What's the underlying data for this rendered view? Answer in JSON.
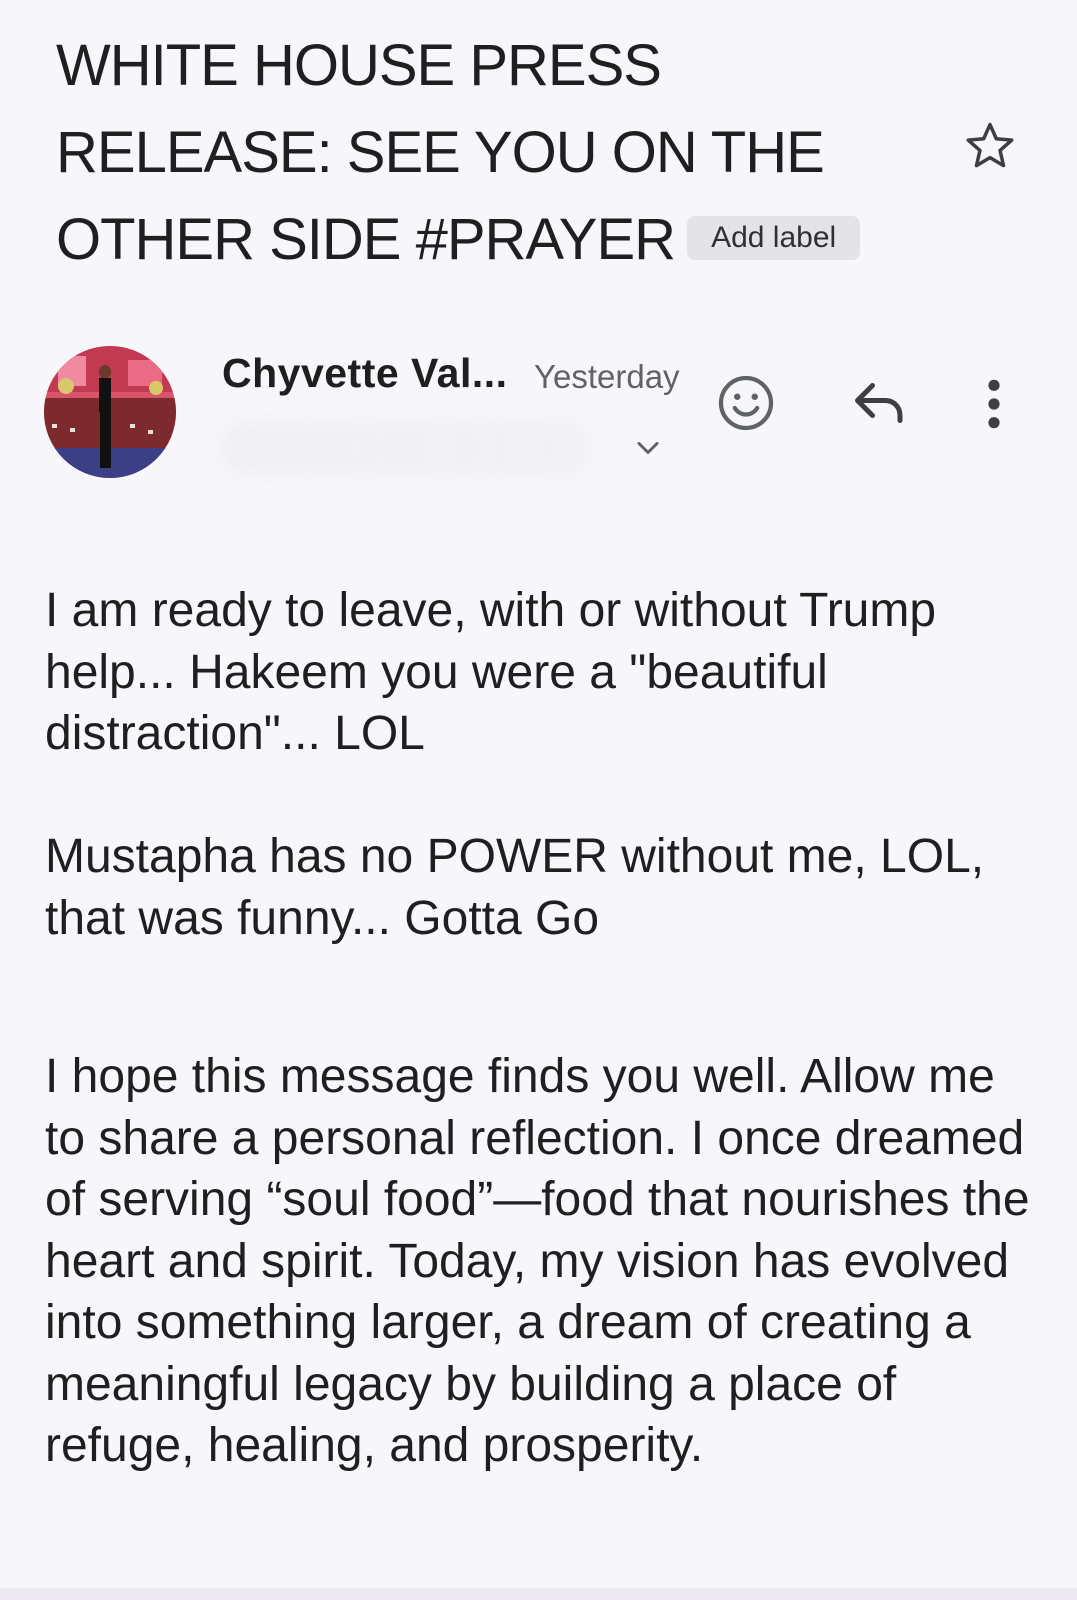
{
  "email": {
    "subject": "WHITE HOUSE PRESS RELEASE: SEE YOU ON THE OTHER SIDE #PRAYER",
    "add_label": "Add label",
    "sender_name": "Chyvette Val...",
    "time": "Yesterday",
    "paragraphs": [
      "I am ready to leave, with or without Trump help... Hakeem you were a \"beautiful distraction\"... LOL",
      "Mustapha has no POWER without me, LOL, that was funny... Gotta Go",
      "I hope this message finds you well. Allow me to share a personal reflection. I once dreamed of serving “soul food”—food that nourishes the heart and spirit. Today, my vision has evolved into something larger, a dream of creating a meaningful legacy by building a place of refuge, healing, and prosperity."
    ]
  },
  "icons": {
    "star": "star-outline-icon",
    "emoji": "add-reaction-icon",
    "reply": "reply-icon",
    "more": "more-vert-icon",
    "expand": "chevron-down-icon"
  },
  "colors": {
    "background": "#f7f6fb",
    "text": "#1f1f1f",
    "secondary": "#5f6368",
    "chip": "#e3e3e8"
  }
}
